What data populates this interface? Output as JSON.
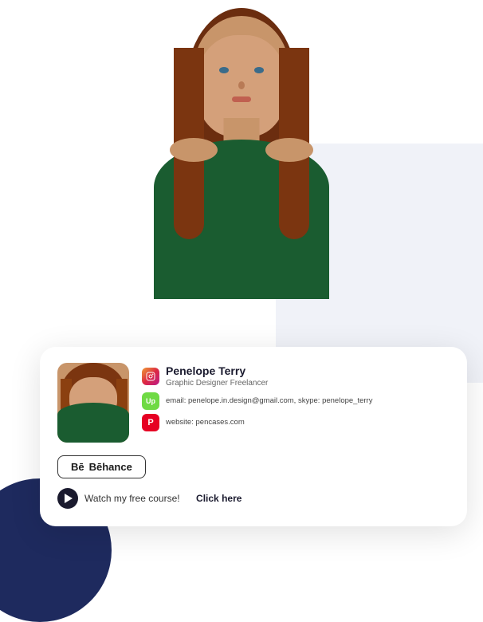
{
  "person": {
    "name": "Penelope Terry",
    "role": "Graphic Designer Freelancer",
    "email": "penelope.in.design@gmail.com",
    "skype": "penelope_terry",
    "website": "pencases.com",
    "email_label": "email:",
    "skype_label": "skype:",
    "website_label": "website:"
  },
  "card": {
    "name": "Penelope Terry",
    "role": "Graphic Designer Freelancer",
    "contact_line1_label": "email:",
    "contact_line1_email": "penelope.in.design@gmail.com,",
    "contact_line1_skype_label": "skype:",
    "contact_line1_skype": "penelope_terry",
    "contact_line2_label": "website:",
    "contact_line2_value": "pencases.com",
    "behance_label": "Bēhance",
    "watch_text": "Watch my free course!",
    "click_label": "Click here"
  },
  "icons": {
    "instagram": "IG",
    "upwork": "Up",
    "pinterest": "P"
  }
}
